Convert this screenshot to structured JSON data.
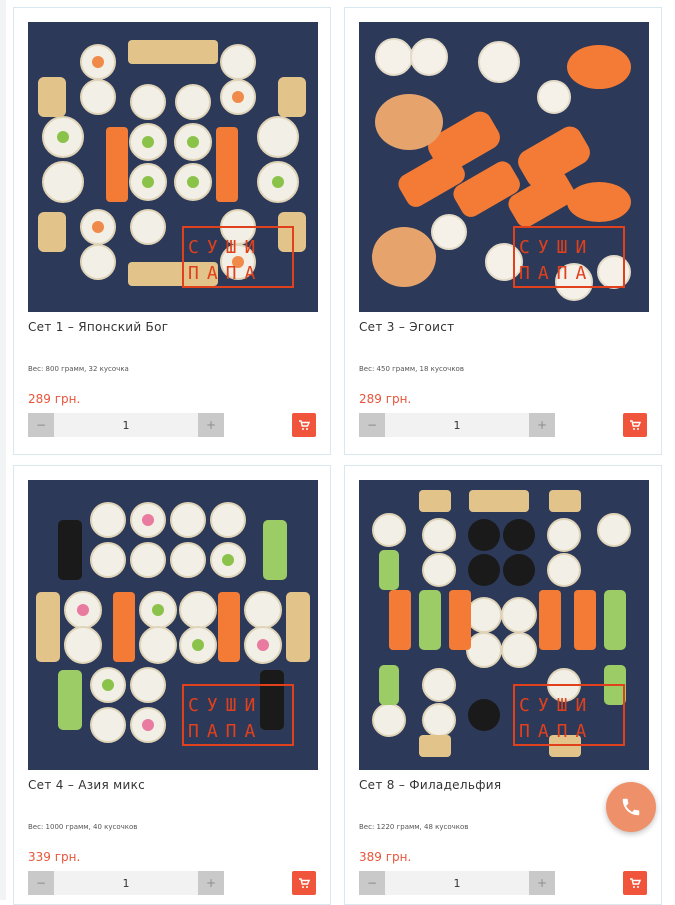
{
  "products": [
    {
      "title": "Сет 1 – Японский Бог",
      "weight": "Вес: 800 грамм, 32 кусочка",
      "price": "289 грн.",
      "quantity": "1",
      "minus": "−",
      "plus": "+"
    },
    {
      "title": "Сет 3 – Эгоист",
      "weight": "Вес: 450 грамм, 18 кусочков",
      "price": "289 грн.",
      "quantity": "1",
      "minus": "−",
      "plus": "+"
    },
    {
      "title": "Сет 4 – Азия микс",
      "weight": "Вес: 1000 грамм, 40 кусочков",
      "price": "339 грн.",
      "quantity": "1",
      "minus": "−",
      "plus": "+"
    },
    {
      "title": "Сет 8 – Филадельфия",
      "weight": "Вес: 1220 грамм, 48 кусочков",
      "price": "389 грн.",
      "quantity": "1",
      "minus": "−",
      "plus": "+"
    }
  ],
  "logo_text": [
    "СУШИ",
    "ПАПА"
  ],
  "icons": {
    "cart": "cart-icon",
    "phone": "phone-icon"
  },
  "colors": {
    "accent": "#f0553b",
    "price": "#e8553b",
    "photo_bg": "#2c3958",
    "fab": "#ee916b"
  }
}
